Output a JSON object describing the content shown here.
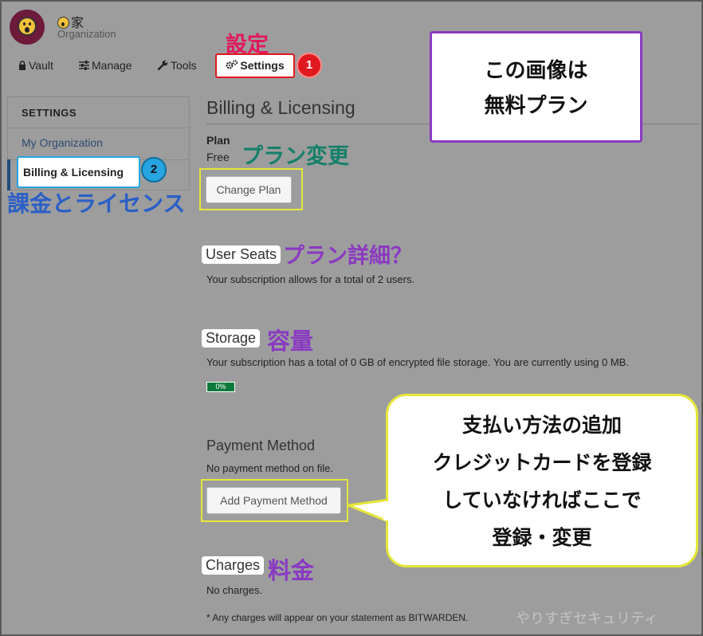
{
  "header": {
    "org_name": "家",
    "org_subtitle": "Organization",
    "tabs": [
      {
        "label": "Vault"
      },
      {
        "label": "Manage"
      },
      {
        "label": "Tools"
      },
      {
        "label": "Settings"
      }
    ]
  },
  "sidebar": {
    "heading": "SETTINGS",
    "items": [
      {
        "label": "My Organization"
      },
      {
        "label": "Billing & Licensing"
      }
    ]
  },
  "main": {
    "title": "Billing & Licensing",
    "plan": {
      "label": "Plan",
      "value": "Free",
      "button": "Change Plan"
    },
    "user_seats": {
      "heading": "User Seats",
      "text": "Your subscription allows for a total of 2 users."
    },
    "storage": {
      "heading": "Storage",
      "text": "Your subscription has a total of 0 GB of encrypted file storage. You are currently using 0 MB.",
      "progress_label": "0%",
      "progress_percent": 0
    },
    "payment": {
      "heading": "Payment Method",
      "text": "No payment method on file.",
      "button": "Add Payment Method"
    },
    "charges": {
      "heading": "Charges",
      "text": "No charges.",
      "footnote": "* Any charges will appear on your statement as BITWARDEN."
    }
  },
  "annotations": {
    "settings_label": "設定",
    "badge1": "1",
    "badge2": "2",
    "change_plan": "プラン変更",
    "billing": "課金とライセンス",
    "plan_detail": "プラン詳細？",
    "storage": "容量",
    "charges": "料金",
    "free_plan_box": [
      "この画像は",
      "無料プラン"
    ],
    "payment_box": [
      "支払い方法の追加",
      "クレジットカードを登録",
      "していなければここで",
      "登録・変更"
    ],
    "watermark": "やりすぎセキュリティ"
  },
  "colors": {
    "background": "#9d9d9d",
    "accent_red": "#e0191e",
    "accent_blue": "#26a5e0",
    "highlight_yellow": "#e6e63a",
    "annotation_purple": "#8a3ac2",
    "progress_green": "#0c7a3a"
  }
}
